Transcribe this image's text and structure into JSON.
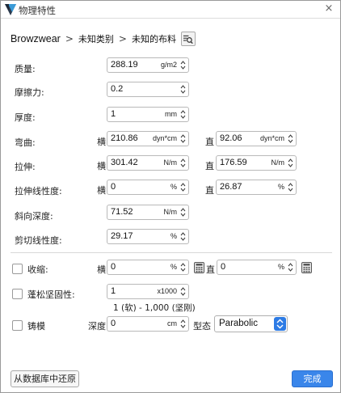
{
  "window": {
    "title": "物理特性",
    "close_label": "×"
  },
  "breadcrumb": {
    "items": [
      "Browzwear",
      "未知类别",
      "未知的布料"
    ],
    "separator": ">"
  },
  "rows": {
    "weight": {
      "label": "质量:",
      "value": "288.19",
      "unit": "g/m2"
    },
    "friction": {
      "label": "摩擦力:",
      "value": "0.2",
      "unit": ""
    },
    "thickness": {
      "label": "厚度:",
      "value": "1",
      "unit": "mm"
    },
    "bending": {
      "label": "弯曲:",
      "weft_label": "横",
      "weft_value": "210.86",
      "weft_unit": "dyn*cm",
      "warp_label": "直",
      "warp_value": "92.06",
      "warp_unit": "dyn*cm"
    },
    "stretch": {
      "label": "拉伸:",
      "weft_label": "横",
      "weft_value": "301.42",
      "weft_unit": "N/m",
      "warp_label": "直",
      "warp_value": "176.59",
      "warp_unit": "N/m"
    },
    "stretch_linearity": {
      "label": "拉伸线性度:",
      "weft_label": "横",
      "weft_value": "0",
      "weft_unit": "%",
      "warp_label": "直",
      "warp_value": "26.87",
      "warp_unit": "%"
    },
    "bias_stretch": {
      "label": "斜向深度:",
      "value": "71.52",
      "unit": "N/m"
    },
    "shear_linearity": {
      "label": "剪切线性度:",
      "value": "29.17",
      "unit": "%"
    }
  },
  "options": {
    "shrinkage": {
      "label": "收缩:",
      "weft_label": "横",
      "weft_value": "0",
      "weft_unit": "%",
      "warp_label": "直",
      "warp_value": "0",
      "warp_unit": "%",
      "checked": false
    },
    "loft": {
      "label": "蓬松坚固性:",
      "value": "1",
      "unit": "x1000",
      "note": "1 (软) - 1,000 (坚刚)",
      "checked": false
    },
    "mold": {
      "label": "铸模",
      "depth_label": "深度",
      "depth_value": "0",
      "depth_unit": "cm",
      "type_label": "型态",
      "type_value": "Parabolic",
      "checked": false
    }
  },
  "footer": {
    "restore_label": "从数据库中还原",
    "done_label": "完成"
  },
  "colors": {
    "accent": "#3a86ea",
    "border": "#b9b9b9"
  },
  "icons": [
    "app-logo-icon",
    "close-icon",
    "fabric-search-icon",
    "spinner-arrows-icon",
    "calculator-icon",
    "select-arrows-icon"
  ]
}
